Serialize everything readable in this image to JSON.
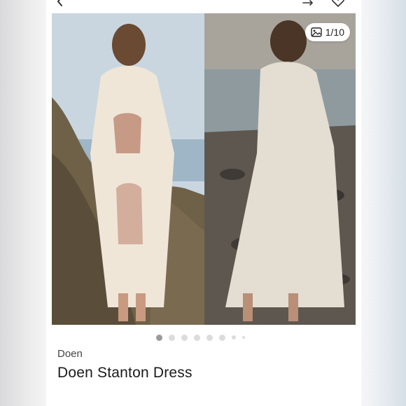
{
  "gallery": {
    "counter_text": "1/10",
    "current_index": 1,
    "total_images": 10,
    "dots_visible": 8
  },
  "product": {
    "brand": "Doen",
    "title": "Doen Stanton Dress"
  },
  "icons": {
    "back": "chevron-left-icon",
    "share": "share-icon",
    "like": "heart-icon",
    "gallery": "image-icon"
  },
  "colors": {
    "dot_active": "#9a9a9a",
    "dot_inactive": "#dcdcdc",
    "text_primary": "#1a1a1a"
  }
}
